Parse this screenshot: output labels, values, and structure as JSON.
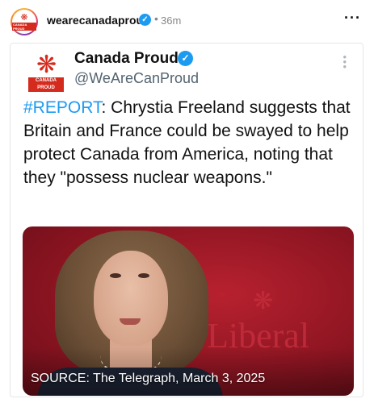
{
  "post": {
    "username": "wearecanadaproud",
    "time": "36m",
    "separator": "•",
    "more_glyph": "···",
    "avatar_text": "CANADA PROUD"
  },
  "tweet": {
    "display_name": "Canada Proud",
    "handle": "@WeAreCanProud",
    "avatar_tag": "CANADA PROUD",
    "hashtag": "#REPORT",
    "body": ": Chrystia Freeland suggests that Britain and France could be swayed to help protect Canada from America, noting that they \"possess nuclear weapons.\"",
    "photo_caption": "SOURCE: The Telegraph, March 3, 2025",
    "photo_background_text": "Liberal"
  },
  "icons": {
    "verified": "verified-check-icon",
    "leaf": "maple-leaf-icon",
    "more": "more-options-icon"
  },
  "colors": {
    "verified_blue": "#1d9bf0",
    "hashtag_blue": "#1d9bf0",
    "brand_red": "#d52b1e",
    "photo_red": "#8e1522"
  }
}
